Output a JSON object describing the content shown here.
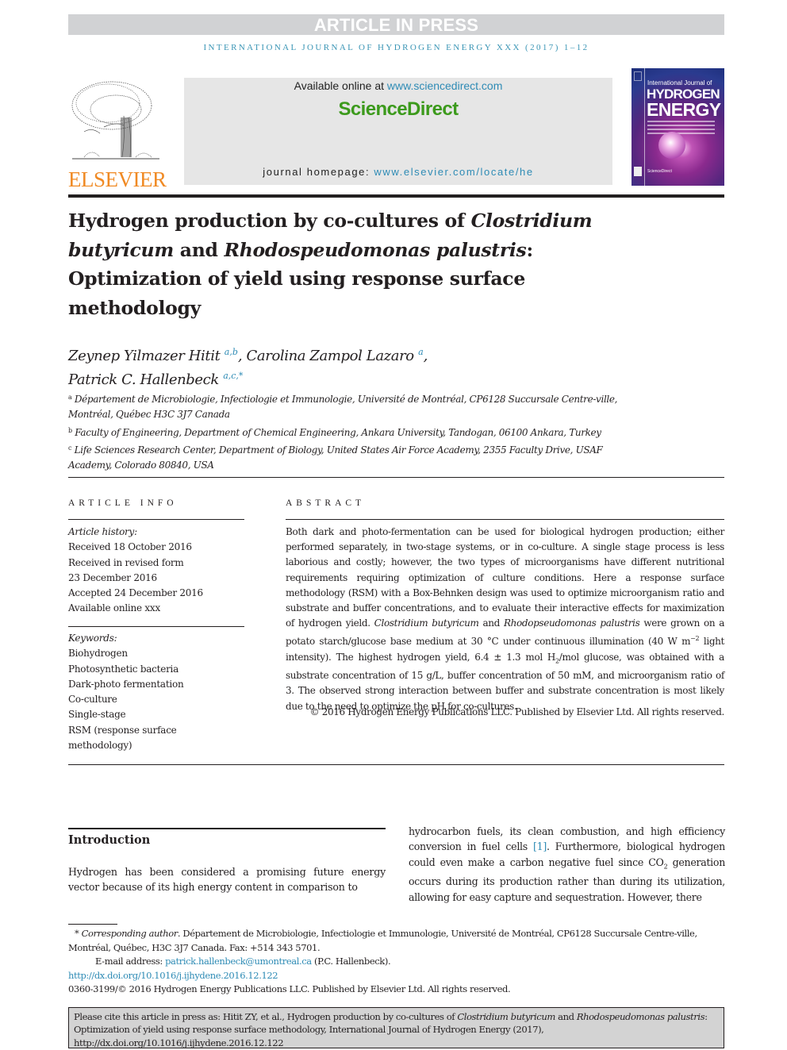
{
  "banner": {
    "article_in_press": "ARTICLE IN PRESS",
    "journal_line": "INTERNATIONAL JOURNAL OF HYDROGEN ENERGY XXX (2017) 1–12"
  },
  "header": {
    "publisher_logo": "ELSEVIER",
    "available_prefix": "Available online at ",
    "available_link": "www.sciencedirect.com",
    "sciencedirect_logo": "ScienceDirect",
    "homepage_prefix": "journal homepage: ",
    "homepage_link": "www.elsevier.com/locate/he",
    "cover": {
      "line1": "International Journal of",
      "line2": "HYDROGEN",
      "line3": "ENERGY",
      "footer": "ScienceDirect"
    },
    "colors": {
      "elsevier_orange": "#f08a24",
      "sciencedirect_green": "#3c9a1c",
      "link_blue": "#2e8bb5",
      "banner_gray": "#d1d2d4"
    }
  },
  "title": {
    "part1": "Hydrogen production by co-cultures of ",
    "italic1": "Clostridium butyricum",
    "part2": " and ",
    "italic2": "Rhodospeudomonas palustris",
    "part3": ": Optimization of yield using response surface methodology"
  },
  "authors": [
    {
      "name": "Zeynep Yilmazer Hitit",
      "affils": "a,b",
      "sep": ", "
    },
    {
      "name": "Carolina Zampol Lazaro",
      "affils": "a",
      "sep": ","
    },
    {
      "name": "Patrick C. Hallenbeck",
      "affils": "a,c,*",
      "sep": ""
    }
  ],
  "affiliations": [
    {
      "key": "a",
      "text": "Département de Microbiologie, Infectiologie et Immunologie, Université de Montréal, CP6128 Succursale Centre-ville, Montréal, Québec H3C 3J7 Canada"
    },
    {
      "key": "b",
      "text": "Faculty of Engineering, Department of Chemical Engineering, Ankara University, Tandogan, 06100 Ankara, Turkey"
    },
    {
      "key": "c",
      "text": "Life Sciences Research Center, Department of Biology, United States Air Force Academy, 2355 Faculty Drive, USAF Academy, Colorado 80840, USA"
    }
  ],
  "article_info": {
    "heading": "ARTICLE INFO",
    "history_label": "Article history:",
    "history": [
      "Received 18 October 2016",
      "Received in revised form",
      "23 December 2016",
      "Accepted 24 December 2016",
      "Available online xxx"
    ],
    "keywords_label": "Keywords:",
    "keywords": [
      "Biohydrogen",
      "Photosynthetic bacteria",
      "Dark-photo fermentation",
      "Co-culture",
      "Single-stage",
      "RSM (response surface methodology)"
    ]
  },
  "abstract": {
    "heading": "ABSTRACT",
    "s1": "Both dark and photo-fermentation can be used for biological hydrogen production; either performed separately, in two-stage systems, or in co-culture. A single stage process is less laborious and costly; however, the two types of microorganisms have different nutritional requirements requiring optimization of culture conditions. Here a response surface methodology (RSM) with a Box-Behnken design was used to optimize microorganism ratio and substrate and buffer concentrations, and to evaluate their interactive effects for maximization of hydrogen yield. ",
    "i1": "Clostridium butyricum",
    "s2": " and ",
    "i2": "Rhodopseudomonas palustris",
    "s3": " were grown on a potato starch/glucose base medium at 30 °C under continuous illumination (40 W m",
    "sup1": "−2",
    "s4": " light intensity). The highest hydrogen yield, 6.4 ± 1.3 mol H",
    "sub1": "2",
    "s5": "/mol glucose, was obtained with a substrate concentration of 15 g/L, buffer concentration of 50 mM, and microorganism ratio of 3. The observed strong interaction between buffer and substrate concentration is most likely due to the need to optimize the pH for co-cultures.",
    "copyright": "© 2016 Hydrogen Energy Publications LLC. Published by Elsevier Ltd. All rights reserved."
  },
  "introduction": {
    "heading": "Introduction",
    "left": "Hydrogen has been considered a promising future energy vector because of its high energy content in comparison to",
    "right1": "hydrocarbon fuels, its clean combustion, and high efficiency conversion in fuel cells ",
    "ref1": "[1]",
    "right2": ". Furthermore, biological hydrogen could even make a carbon negative fuel since CO",
    "sub": "2",
    "right3": " generation occurs during its production rather than during its utilization, allowing for easy capture and sequestration. However, there"
  },
  "footnotes": {
    "star": "* ",
    "corr_label": "Corresponding author",
    "corr_text": ". Département de Microbiologie, Infectiologie et Immunologie, Université de Montréal, CP6128 Succursale Centre-ville, Montréal, Québec, H3C 3J7 Canada. Fax: +514 343 5701.",
    "email_label": "E-mail address: ",
    "email": "patrick.hallenbeck@umontreal.ca",
    "email_suffix": " (P.C. Hallenbeck).",
    "doi": "http://dx.doi.org/10.1016/j.ijhydene.2016.12.122",
    "issn": "0360-3199/© 2016 Hydrogen Energy Publications LLC. Published by Elsevier Ltd. All rights reserved."
  },
  "citation": {
    "p1": "Please cite this article in press as: Hitit ZY, et al., Hydrogen production by co-cultures of ",
    "i1": "Clostridium butyricum",
    "p2": " and ",
    "i2": "Rhodospeudomonas palustris",
    "p3": ": Optimization of yield using response surface methodology, International Journal of Hydrogen Energy (2017), http://dx.doi.org/10.1016/j.ijhydene.2016.12.122"
  }
}
